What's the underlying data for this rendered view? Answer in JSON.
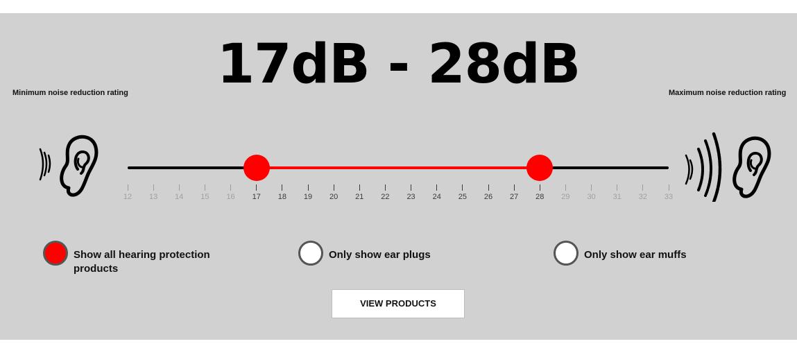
{
  "title": "17dB - 28dB",
  "labels": {
    "min": "Minimum noise reduction rating",
    "max": "Maximum noise reduction rating"
  },
  "icons": {
    "left": "ear-quiet-icon",
    "right": "ear-loud-icon"
  },
  "slider": {
    "min": 12,
    "max": 33,
    "selected_low": 17,
    "selected_high": 28,
    "ticks": [
      "12",
      "13",
      "14",
      "15",
      "16",
      "17",
      "18",
      "19",
      "20",
      "21",
      "22",
      "23",
      "24",
      "25",
      "26",
      "27",
      "28",
      "29",
      "30",
      "31",
      "32",
      "33"
    ]
  },
  "filters": [
    {
      "label": "Show all hearing protection products",
      "selected": true
    },
    {
      "label": "Only show ear plugs",
      "selected": false
    },
    {
      "label": "Only show ear muffs",
      "selected": false
    }
  ],
  "button": {
    "label": "VIEW PRODUCTS"
  },
  "colors": {
    "accent": "#ff0000",
    "panel": "#d1d1d1",
    "track": "#000000"
  }
}
